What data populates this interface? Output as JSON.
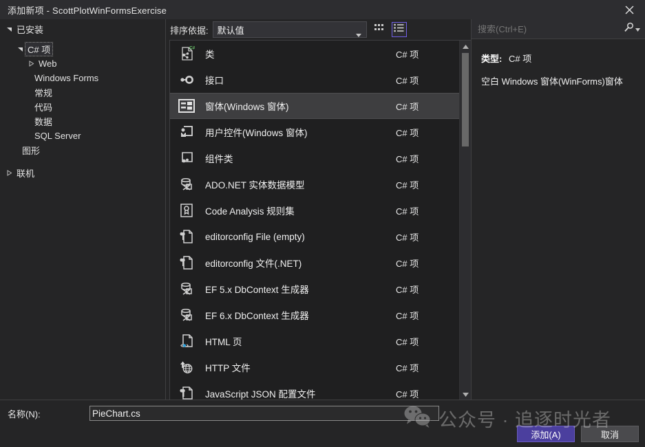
{
  "window": {
    "title": "添加新项 - ScottPlotWinFormsExercise",
    "close_icon": "close-icon"
  },
  "sidebar": {
    "header": {
      "label": "已安装",
      "expanded": true
    },
    "tree": [
      {
        "label": "C# 项",
        "level": 1,
        "twisty": "expanded",
        "selected": true
      },
      {
        "label": "Web",
        "level": 2,
        "twisty": "collapsed",
        "selected": false
      },
      {
        "label": "Windows Forms",
        "level": 2,
        "twisty": "none",
        "selected": false
      },
      {
        "label": "常规",
        "level": 2,
        "twisty": "none",
        "selected": false
      },
      {
        "label": "代码",
        "level": 2,
        "twisty": "none",
        "selected": false
      },
      {
        "label": "数据",
        "level": 2,
        "twisty": "none",
        "selected": false
      },
      {
        "label": "SQL Server",
        "level": 2,
        "twisty": "none",
        "selected": false
      },
      {
        "label": "图形",
        "level": 1,
        "twisty": "none",
        "selected": false
      }
    ],
    "online": {
      "label": "联机",
      "twisty": "collapsed"
    }
  },
  "toolbar": {
    "sort_label": "排序依据:",
    "sort_value": "默认值",
    "view_tiles_name": "tiles-view-icon",
    "view_list_name": "list-view-icon",
    "active_view": "list"
  },
  "list": {
    "kind_default": "C# 项",
    "items": [
      {
        "name": "类",
        "kind": "C# 项",
        "icon": "class-icon",
        "selected": false
      },
      {
        "name": "接口",
        "kind": "C# 项",
        "icon": "interface-icon",
        "selected": false
      },
      {
        "name": "窗体(Windows 窗体)",
        "kind": "C# 项",
        "icon": "windows-form-icon",
        "selected": true
      },
      {
        "name": "用户控件(Windows 窗体)",
        "kind": "C# 项",
        "icon": "user-control-icon",
        "selected": false
      },
      {
        "name": "组件类",
        "kind": "C# 项",
        "icon": "component-class-icon",
        "selected": false
      },
      {
        "name": "ADO.NET 实体数据模型",
        "kind": "C# 项",
        "icon": "database-model-icon",
        "selected": false
      },
      {
        "name": "Code Analysis 规则集",
        "kind": "C# 项",
        "icon": "ruleset-icon",
        "selected": false
      },
      {
        "name": "editorconfig File (empty)",
        "kind": "C# 项",
        "icon": "config-file-icon",
        "selected": false
      },
      {
        "name": "editorconfig 文件(.NET)",
        "kind": "C# 项",
        "icon": "config-file-icon",
        "selected": false
      },
      {
        "name": "EF 5.x DbContext 生成器",
        "kind": "C# 项",
        "icon": "database-model-icon",
        "selected": false
      },
      {
        "name": "EF 6.x DbContext 生成器",
        "kind": "C# 项",
        "icon": "database-model-icon",
        "selected": false
      },
      {
        "name": "HTML 页",
        "kind": "C# 项",
        "icon": "html-page-icon",
        "selected": false
      },
      {
        "name": "HTTP 文件",
        "kind": "C# 项",
        "icon": "http-file-icon",
        "selected": false
      },
      {
        "name": "JavaScript JSON 配置文件",
        "kind": "C# 项",
        "icon": "json-config-icon",
        "selected": false
      }
    ],
    "scroll": {
      "up_icon": "scroll-up-icon",
      "down_icon": "scroll-down-icon"
    }
  },
  "search": {
    "placeholder": "搜索(Ctrl+E)",
    "icon": "search-icon",
    "dropdown_icon": "chevron-down-icon"
  },
  "detail": {
    "type_label": "类型:",
    "type_value": "C# 项",
    "description": "空白 Windows 窗体(WinForms)窗体"
  },
  "footer": {
    "name_label": "名称(N):",
    "name_value": "PieChart.cs",
    "add_button": "添加(A)",
    "cancel_button": "取消"
  },
  "watermark": {
    "text": "公众号 · 追逐时光者",
    "icon": "wechat-icon"
  },
  "colors": {
    "accent": "#4b3f9e",
    "selection": "#3e3e40",
    "background": "#252526",
    "list_background": "#1f1f20",
    "toggle_border": "#7160e8"
  }
}
